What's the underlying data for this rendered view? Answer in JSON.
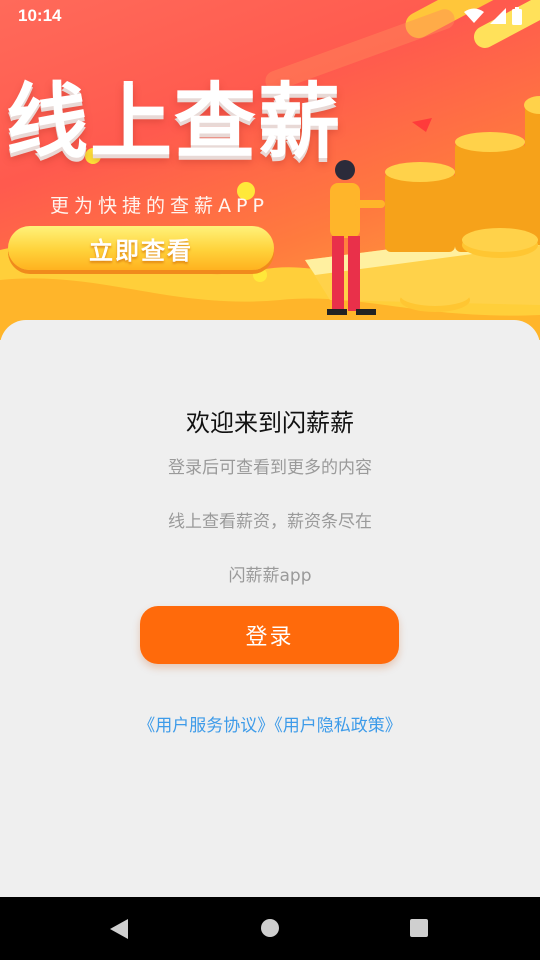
{
  "status_bar": {
    "time": "10:14",
    "icons": [
      "wifi-icon",
      "signal-icon",
      "battery-icon"
    ]
  },
  "banner": {
    "title": "线上查薪",
    "subtitle": "更为快捷的查薪APP",
    "cta_label": "立即查看"
  },
  "welcome": {
    "title": "欢迎来到闪薪薪",
    "line1": "登录后可查看到更多的内容",
    "line2": "线上查看薪资，薪资条尽在",
    "line3": "闪薪薪app"
  },
  "login": {
    "label": "登录"
  },
  "agreements": {
    "service": "《用户服务协议》",
    "privacy": "《用户隐私政策》"
  },
  "nav": {
    "icons": [
      "back-icon",
      "home-icon",
      "recents-icon"
    ]
  },
  "colors": {
    "accent": "#ff6a0b",
    "link": "#3d9be9",
    "banner_red": "#ff5a4e",
    "banner_gold": "#ffb13a"
  }
}
